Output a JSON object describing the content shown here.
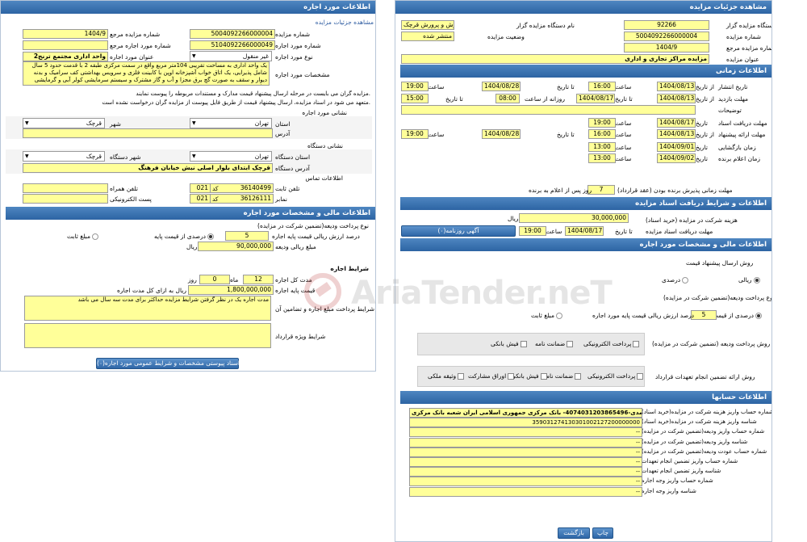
{
  "left": {
    "header": "اطلاعات مورد اجاره",
    "link": "مشاهده جزئیات مزایده",
    "l_ref_no_label": "شماره مزایده مرجع",
    "l_ref_no": "1404/9",
    "l_auction_no_label": "شماره مزایده",
    "l_auction_no": "5004092266000004",
    "l_ref_item_label": "شماره مورد اجاره مرجع",
    "l_item_no_label": "شماره مورد اجاره",
    "l_item_no": "5104092266000049",
    "l_item_type_label": "نوع مورد اجاره",
    "l_item_type": "غیر منقول",
    "l_item_title_label": "عنوان مورد اجاره",
    "l_item_title": "واحد اداری مجتمع ترنج2",
    "l_specs_label": "مشخصات مورد اجاره",
    "l_specs": "یک واحد اداری به مساحت تقریبی 104متر مربع واقع در سمت مرکزی طبقه 2 با قدمت حدود 5 سال شامل پذیرایی، یک اتاق خواب آشپزخانه اوپن با کابینت فلزی و سرویس بهداشتی کف سرامیک و بدنه دیوار و سقف به صورت گچ برق مجزا و آب و گاز مشترک و سیستم سرمایشی کولر آبی و گرمایشی بخاری",
    "notice1": "مزایده گران می بایست در مرحله ارسال پیشنهاد قیمت مدارک و مستندات مربوطه را پیوست نمایند.",
    "notice2": "متعهد می شود در اسناد مزایده، ارسال پیشنهاد قیمت از طریق فایل پیوست از مزایده گران درخواست نشده است.",
    "addr_section": "نشانی مورد اجاره",
    "province_label": "استان",
    "province": "تهران",
    "city_label": "شهر",
    "city": "قرچک",
    "address_label": "آدرس",
    "org_addr_section": "نشانی دستگاه",
    "org_province_label": "استان دستگاه",
    "org_province": "تهران",
    "org_city_label": "شهر دستگاه",
    "org_city": "قرچک",
    "org_address_label": "آدرس دستگاه",
    "org_address": "قرچک ابتدای بلوار اصلی نبش خیابان فرهنگ",
    "contact_section": "اطلاعات تماس",
    "phone_label": "تلفن ثابت",
    "phone": "36140499",
    "code_label": "کد",
    "phone_code": "021",
    "mobile_label": "تلفن همراه",
    "fax_label": "نمابر",
    "fax": "36126111",
    "fax_code": "021",
    "email_label": "پست الکترونیکی",
    "fin_header": "اطلاعات مالی و مشخصات مورد اجاره",
    "deposit_type_label": "نوع پرداخت ودیعه(تضمین شرکت در مزایده)",
    "percent_label": "درصدی از قیمت پایه",
    "fixed_label": "مبلغ ثابت",
    "percent_value": "5",
    "percent_desc": "درصد ارزش ریالی قیمت پایه اجاره",
    "deposit_amount_label": "مبلغ ریالی ودیعه",
    "deposit_amount": "90,000,000",
    "rial": "ریال",
    "lease_section": "شرایط اجاره",
    "duration_label": "مدت کل اجاره",
    "duration_months": "12",
    "month_label": "ماه",
    "duration_days": "0",
    "day_label": "روز",
    "base_price_label": "قیمت پایه اجاره",
    "base_price": "1,800,000,000",
    "base_price_desc": "ریال به ازای کل مدت اجاره",
    "lease_terms_label": "شرایط پرداخت مبلغ اجاره و تضامین آن",
    "lease_terms": "مدت اجاره یک  در نظر گرفتن شرایط مزایده حداکثر برای مدت سه سال می باشد",
    "special_terms_label": "شرایط ویژه قرارداد",
    "attach_button": "اسناد پیوستی مشخصات و شرایط عمومی مورد اجاره(۰)"
  },
  "right": {
    "header": "مشاهده جزئیات مزایده",
    "org_code_label": "کد دستگاه مزایده گزار",
    "org_code": "92266",
    "org_name_label": "نام دستگاه مزایده گزار",
    "org_name": "مدیریت آموزش و پرورش قرچک",
    "auction_no_label": "شماره مزایده",
    "auction_no": "5004092266000004",
    "status_label": "وضعیت مزایده",
    "status": "منتشر شده",
    "ref_no_label": "شماره مزایده مرجع",
    "ref_no": "1404/9",
    "title_label": "عنوان مزایده",
    "title": "مزایده مراکز تجاری و اداری",
    "time_header": "اطلاعات زمانی",
    "publish_label": "تاریخ انتشار",
    "from_date_label": "از تاریخ",
    "to_date_label": "تا تاریخ",
    "time_label": "ساعت",
    "daily_from_label": "روزانه از ساعت",
    "publish_from": "1404/08/13",
    "publish_from_time": "16:00",
    "publish_to": "1404/08/28",
    "publish_to_time": "19:00",
    "visit_label": "مهلت بازدید",
    "visit_from": "1404/08/13",
    "visit_to": "1404/08/17",
    "visit_daily_from": "08:00",
    "visit_daily_to": "15:00",
    "desc_label": "توضیحات",
    "doc_deadline_label": "مهلت دریافت اسناد",
    "date_label": "تاریخ",
    "doc_deadline": "1404/08/17",
    "doc_deadline_time": "19:00",
    "bid_label": "مهلت ارائه پیشنهاد",
    "bid_from": "1404/08/13",
    "bid_from_time": "16:00",
    "bid_to": "1404/08/28",
    "bid_to_time": "19:00",
    "open_label": "زمان بازگشایی",
    "open_date": "1404/09/01",
    "open_time": "13:00",
    "winner_label": "زمان اعلام برنده",
    "winner_date": "1404/09/02",
    "winner_time": "13:00",
    "validity_label": "مهلت زمانی پذیرش برنده بودن (عقد قرارداد)",
    "validity_days": "7",
    "validity_desc": "روز پس از اعلام به برنده",
    "doc_header": "اطلاعات و شرایط دریافت اسناد مزایده",
    "doc_fee_label": "هزینه شرکت در مزایده (خرید اسناد)",
    "doc_fee": "30,000,000",
    "doc_fee_unit": "ریال",
    "doc_get_label": "مهلت دریافت اسناد مزایده",
    "doc_get_date": "1404/08/17",
    "doc_get_time": "19:00",
    "newspaper_button": "آگهی روزنامه(۰)",
    "fin_header": "اطلاعات مالی و مشخصات مورد اجاره",
    "bid_method_label": "روش ارسال پیشنهاد قیمت",
    "rial_option": "ریالی",
    "percent_option": "درصدی",
    "deposit_type_label": "نوع پرداخت ودیعه(تضمین شرکت در مزایده)",
    "percent_base_label": "درصدی از قیمت پایه",
    "fixed_label": "مبلغ ثابت",
    "percent_value": "5",
    "percent_desc": "درصد ارزش ریالی قیمت پایه مورد اجاره",
    "pay_method_label": "روش پرداخت ودیعه (تضمین شرکت در مزایده)",
    "pay_electronic": "پرداخت الکترونیکی",
    "pay_guarantee": "ضمانت نامه",
    "pay_receipt": "فیش بانکی",
    "commit_label": "روش ارائه تضمین انجام تعهدات قرارداد",
    "commit_electronic": "پرداخت الکترونیکی",
    "commit_guarantee": "ضمانت نامه",
    "commit_receipt": "فیش بانکی",
    "commit_bonds": "اوراق مشارکت",
    "commit_property": "وثیقه ملکی",
    "acc_header": "اطلاعات حسابها",
    "acc_rows": [
      {
        "label": "شماره حساب واریز هزینه شرکت در مزایده(خرید اسناد)",
        "value": "درآمدی-4074031203865496- بانک مرکزی جمهوری اسلامی ایران شعبه بانک مرکزی"
      },
      {
        "label": "شناسه واریز هزینه شرکت در مزایده(خرید اسناد)",
        "value": "359031274130301002127200000000"
      },
      {
        "label": "شماره حساب واریز ودیعه(تضمین شرکت در مزایده)",
        "value": "--"
      },
      {
        "label": "شناسه واریز ودیعه(تضمین شرکت در مزایده)",
        "value": "--"
      },
      {
        "label": "شماره حساب عودت ودیعه(تضمین شرکت در مزایده)",
        "value": "--"
      },
      {
        "label": "شماره حساب واریز تضمین انجام تعهدات",
        "value": "--"
      },
      {
        "label": "شناسه واریز تضمین انجام تعهدات",
        "value": "--"
      },
      {
        "label": "شماره حساب واریز وجه اجاره",
        "value": "--"
      },
      {
        "label": "شناسه واریز وجه اجاره",
        "value": "--"
      }
    ],
    "print_button": "چاپ",
    "back_button": "بازگشت"
  },
  "watermark": "AriaTender.neT",
  "colors": {
    "header": "#2d64a3",
    "field": "#ffff99",
    "border": "#b7c6d8"
  }
}
